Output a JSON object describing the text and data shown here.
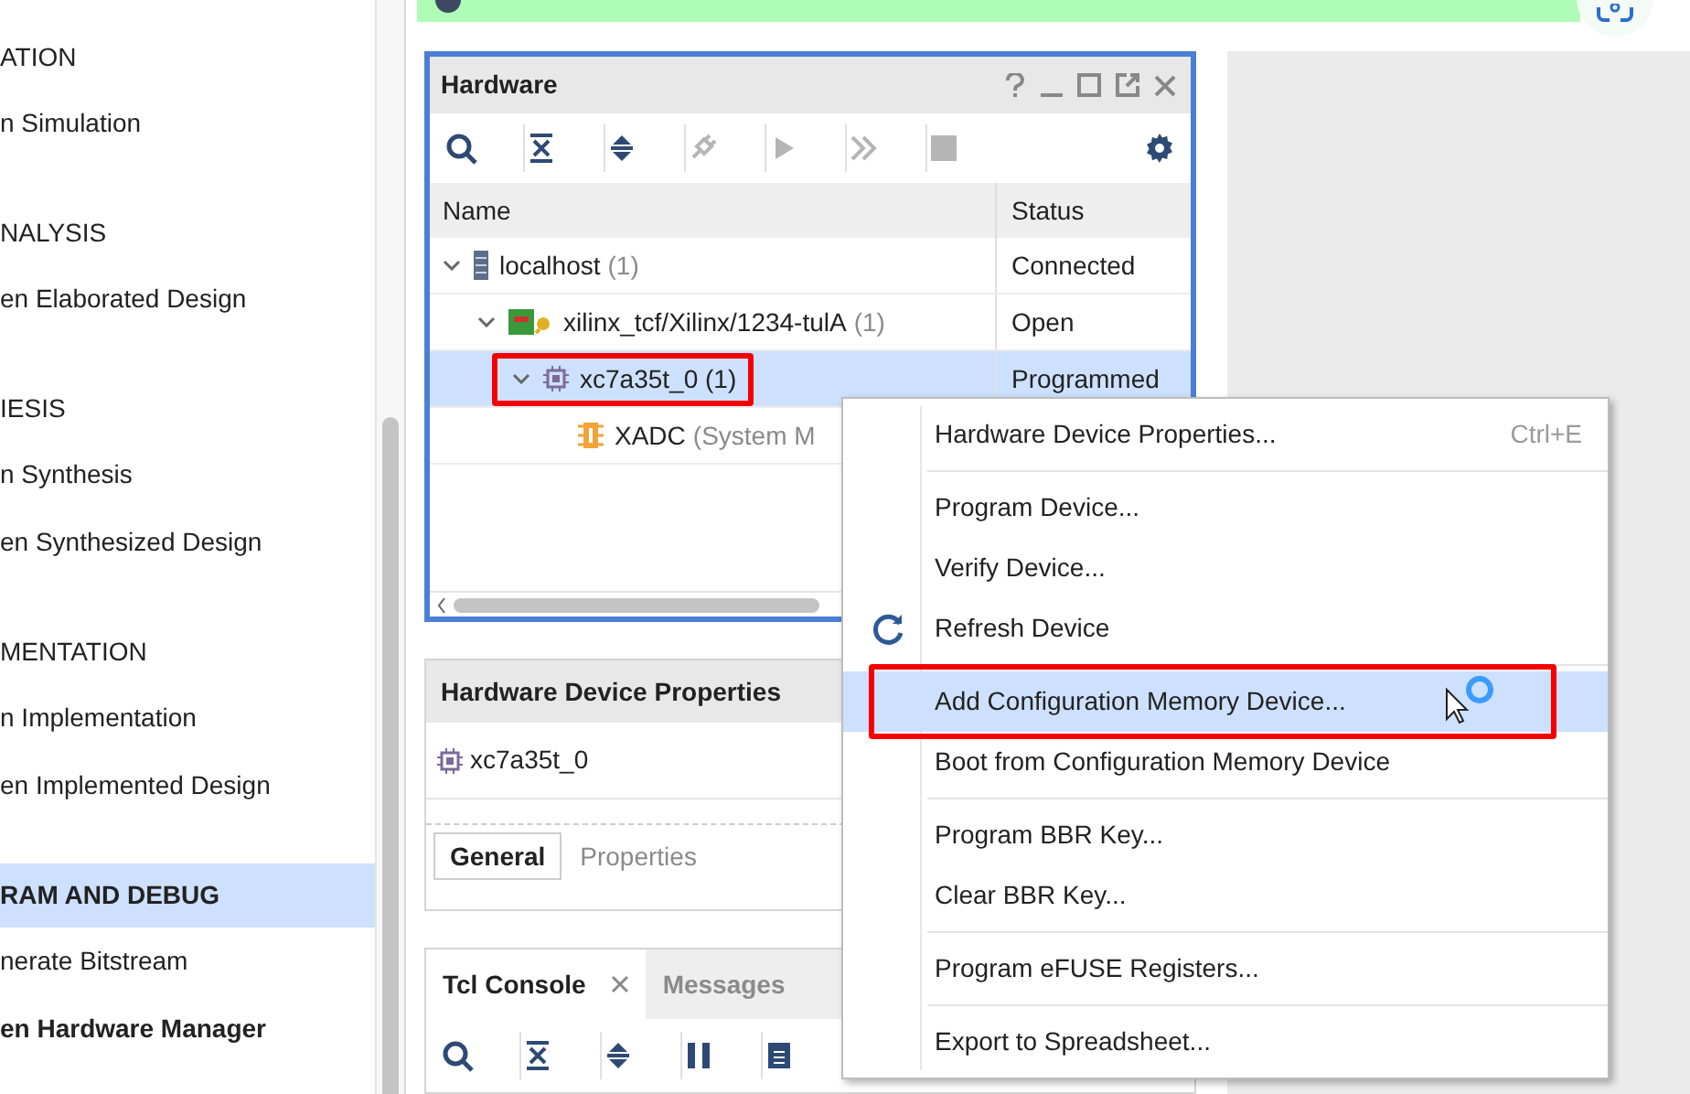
{
  "sidebar": {
    "groups": [
      {
        "header": "ATION",
        "selected": false,
        "items": [
          {
            "label": "n Simulation",
            "bold": false
          }
        ]
      },
      {
        "header": "NALYSIS",
        "selected": false,
        "items": [
          {
            "label": "en Elaborated Design",
            "bold": false
          }
        ]
      },
      {
        "header": "IESIS",
        "selected": false,
        "items": [
          {
            "label": "n Synthesis",
            "bold": false
          },
          {
            "label": "en Synthesized Design",
            "bold": false
          }
        ]
      },
      {
        "header": "MENTATION",
        "selected": false,
        "items": [
          {
            "label": "n Implementation",
            "bold": false
          },
          {
            "label": "en Implemented Design",
            "bold": false
          }
        ]
      },
      {
        "header": "RAM AND DEBUG",
        "selected": true,
        "items": [
          {
            "label": "nerate Bitstream",
            "bold": false
          },
          {
            "label": "en Hardware Manager",
            "bold": true
          }
        ]
      }
    ]
  },
  "hardware": {
    "title": "Hardware",
    "columns": [
      "Name",
      "Status"
    ],
    "tree": [
      {
        "label": "localhost",
        "suffix": "(1)",
        "status": "Connected",
        "kind": "server",
        "expanded": true,
        "selected": false,
        "annotated": false,
        "children": [
          {
            "label": "xilinx_tcf/Xilinx/1234-tulA",
            "suffix": "(1)",
            "status": "Open",
            "kind": "board",
            "expanded": true,
            "selected": false,
            "annotated": false,
            "children": [
              {
                "label": "xc7a35t_0 (1)",
                "status": "Programmed",
                "kind": "chip",
                "expanded": true,
                "selected": true,
                "annotated": true,
                "children": [
                  {
                    "label": "XADC",
                    "suffix": "(System M",
                    "kind": "xadc",
                    "selected": false,
                    "annotated": false
                  }
                ]
              }
            ]
          }
        ]
      }
    ]
  },
  "properties": {
    "title": "Hardware Device Properties",
    "device": "xc7a35t_0",
    "tabs": [
      {
        "label": "General",
        "selected": true
      },
      {
        "label": "Properties",
        "selected": false
      }
    ]
  },
  "console": {
    "tabs": [
      {
        "label": "Tcl Console",
        "selected": true,
        "closable": true
      },
      {
        "label": "Messages",
        "selected": false,
        "closable": false
      }
    ]
  },
  "context_menu": [
    {
      "kind": "item",
      "label": "Hardware Device Properties...",
      "shortcut": "Ctrl+E",
      "selected": false,
      "annotated": false
    },
    {
      "kind": "separator"
    },
    {
      "kind": "item",
      "label": "Program Device...",
      "selected": false,
      "annotated": false
    },
    {
      "kind": "item",
      "label": "Verify Device...",
      "selected": false,
      "annotated": false
    },
    {
      "kind": "item",
      "label": "Refresh Device",
      "icon": true,
      "selected": false,
      "annotated": false
    },
    {
      "kind": "separator"
    },
    {
      "kind": "item",
      "label": "Add Configuration Memory Device...",
      "selected": true,
      "annotated": true
    },
    {
      "kind": "item",
      "label": "Boot from Configuration Memory Device",
      "selected": false,
      "annotated": false
    },
    {
      "kind": "separator"
    },
    {
      "kind": "item",
      "label": "Program BBR Key...",
      "selected": false,
      "annotated": false
    },
    {
      "kind": "item",
      "label": "Clear BBR Key...",
      "selected": false,
      "annotated": false
    },
    {
      "kind": "separator"
    },
    {
      "kind": "item",
      "label": "Program eFUSE Registers...",
      "selected": false,
      "annotated": false
    },
    {
      "kind": "separator"
    },
    {
      "kind": "item",
      "label": "Export to Spreadsheet...",
      "selected": false,
      "annotated": false
    }
  ]
}
